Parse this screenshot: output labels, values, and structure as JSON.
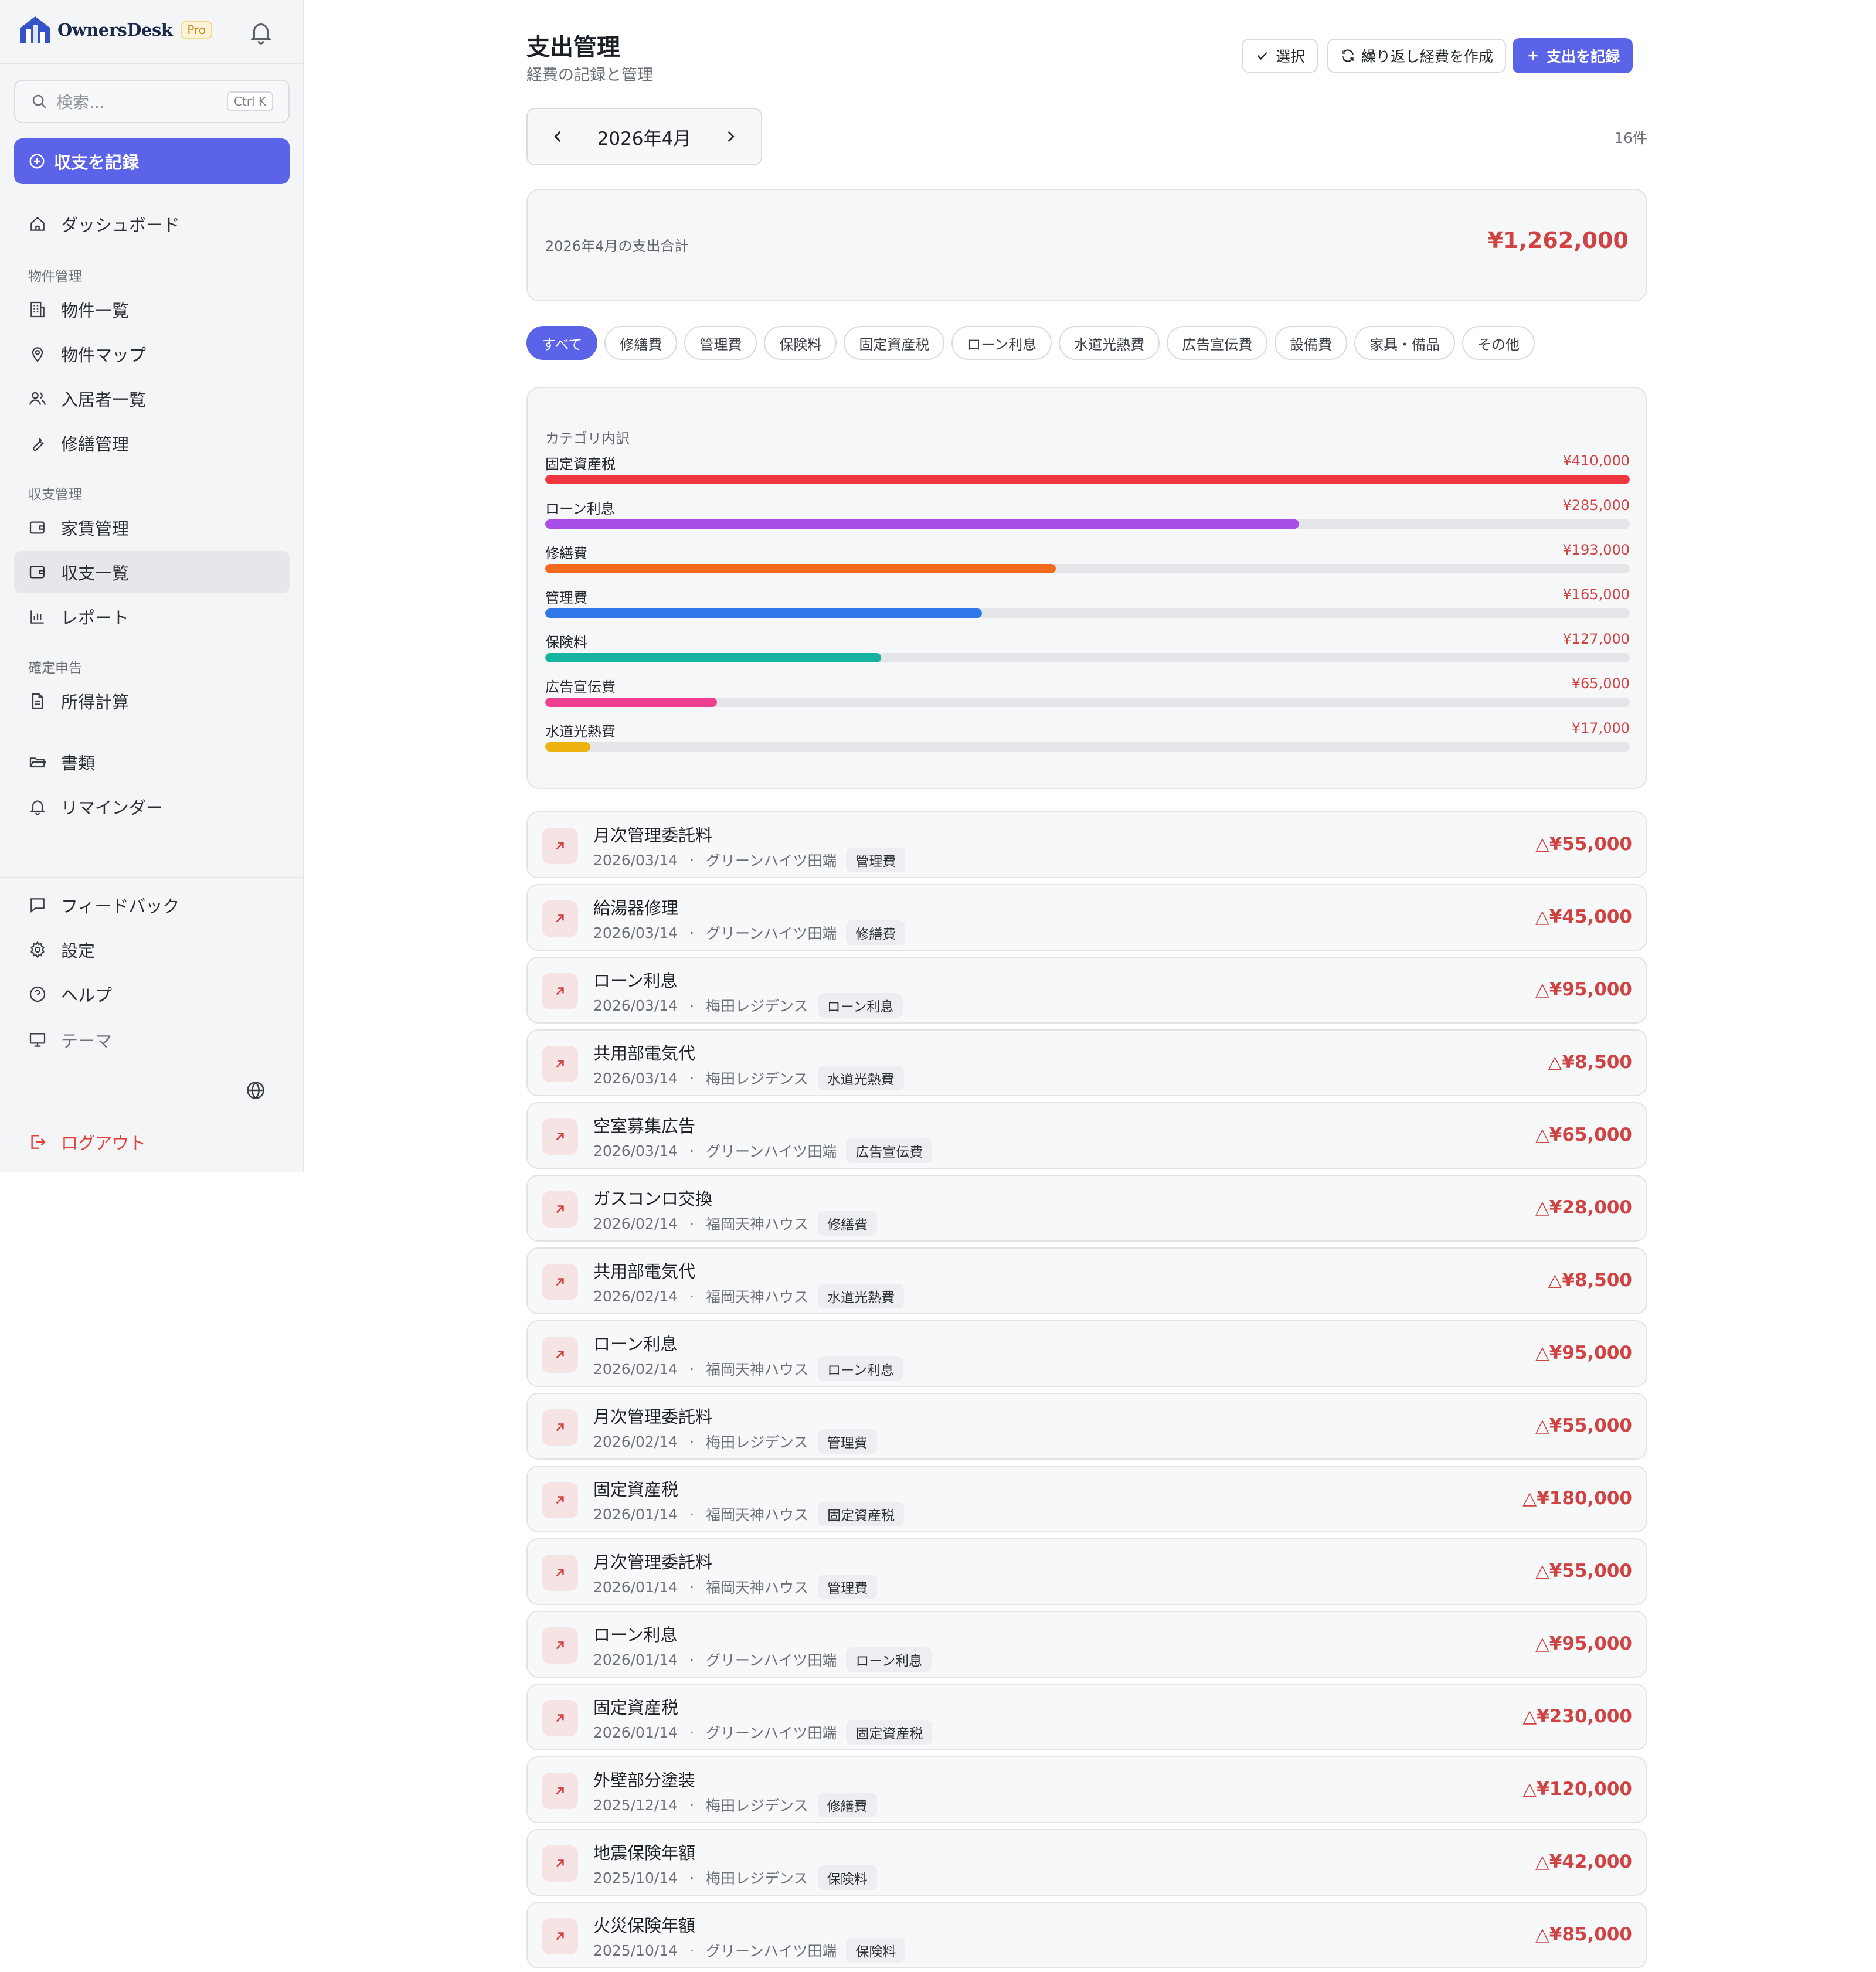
{
  "app": {
    "name": "OwnersDesk",
    "plan_badge": "Pro"
  },
  "search": {
    "placeholder": "検索...",
    "shortcut": "Ctrl K"
  },
  "sidebar": {
    "record_button": "収支を記録",
    "dashboard": "ダッシュボード",
    "section_property": "物件管理",
    "property_list": "物件一覧",
    "property_map": "物件マップ",
    "tenant_list": "入居者一覧",
    "repair": "修繕管理",
    "section_finance": "収支管理",
    "rent": "家賃管理",
    "ledger": "収支一覧",
    "report": "レポート",
    "section_tax": "確定申告",
    "income_calc": "所得計算",
    "documents": "書類",
    "reminder": "リマインダー",
    "feedback": "フィードバック",
    "settings": "設定",
    "help": "ヘルプ",
    "theme": "テーマ",
    "logout": "ログアウト"
  },
  "header": {
    "title": "支出管理",
    "subtitle": "経費の記録と管理",
    "select_button": "選択",
    "recurring_button": "繰り返し経費を作成",
    "record_expense_button": "支出を記録"
  },
  "month": {
    "label": "2026年4月",
    "count": "16件"
  },
  "total": {
    "label": "2026年4月の支出合計",
    "value": "¥1,262,000"
  },
  "filters": [
    "すべて",
    "修繕費",
    "管理費",
    "保険料",
    "固定資産税",
    "ローン利息",
    "水道光熱費",
    "広告宣伝費",
    "設備費",
    "家具・備品",
    "その他"
  ],
  "categories": {
    "title": "カテゴリ内訳",
    "items": [
      {
        "name": "固定資産税",
        "amount": "¥410,000",
        "value": 410000,
        "color": "#f0373f"
      },
      {
        "name": "ローン利息",
        "amount": "¥285,000",
        "value": 285000,
        "color": "#a64ee6"
      },
      {
        "name": "修繕費",
        "amount": "¥193,000",
        "value": 193000,
        "color": "#f46a1d"
      },
      {
        "name": "管理費",
        "amount": "¥165,000",
        "value": 165000,
        "color": "#2f76e8"
      },
      {
        "name": "保険料",
        "amount": "¥127,000",
        "value": 127000,
        "color": "#15b3a0"
      },
      {
        "name": "広告宣伝費",
        "amount": "¥65,000",
        "value": 65000,
        "color": "#ee3f91"
      },
      {
        "name": "水道光熱費",
        "amount": "¥17,000",
        "value": 17000,
        "color": "#eeb20d"
      }
    ]
  },
  "transactions": [
    {
      "title": "月次管理委託料",
      "date": "2026/03/14",
      "property": "グリーンハイツ田端",
      "category": "管理費",
      "amount": "△¥55,000"
    },
    {
      "title": "給湯器修理",
      "date": "2026/03/14",
      "property": "グリーンハイツ田端",
      "category": "修繕費",
      "amount": "△¥45,000"
    },
    {
      "title": "ローン利息",
      "date": "2026/03/14",
      "property": "梅田レジデンス",
      "category": "ローン利息",
      "amount": "△¥95,000"
    },
    {
      "title": "共用部電気代",
      "date": "2026/03/14",
      "property": "梅田レジデンス",
      "category": "水道光熱費",
      "amount": "△¥8,500"
    },
    {
      "title": "空室募集広告",
      "date": "2026/03/14",
      "property": "グリーンハイツ田端",
      "category": "広告宣伝費",
      "amount": "△¥65,000"
    },
    {
      "title": "ガスコンロ交換",
      "date": "2026/02/14",
      "property": "福岡天神ハウス",
      "category": "修繕費",
      "amount": "△¥28,000"
    },
    {
      "title": "共用部電気代",
      "date": "2026/02/14",
      "property": "福岡天神ハウス",
      "category": "水道光熱費",
      "amount": "△¥8,500"
    },
    {
      "title": "ローン利息",
      "date": "2026/02/14",
      "property": "福岡天神ハウス",
      "category": "ローン利息",
      "amount": "△¥95,000"
    },
    {
      "title": "月次管理委託料",
      "date": "2026/02/14",
      "property": "梅田レジデンス",
      "category": "管理費",
      "amount": "△¥55,000"
    },
    {
      "title": "固定資産税",
      "date": "2026/01/14",
      "property": "福岡天神ハウス",
      "category": "固定資産税",
      "amount": "△¥180,000"
    },
    {
      "title": "月次管理委託料",
      "date": "2026/01/14",
      "property": "福岡天神ハウス",
      "category": "管理費",
      "amount": "△¥55,000"
    },
    {
      "title": "ローン利息",
      "date": "2026/01/14",
      "property": "グリーンハイツ田端",
      "category": "ローン利息",
      "amount": "△¥95,000"
    },
    {
      "title": "固定資産税",
      "date": "2026/01/14",
      "property": "グリーンハイツ田端",
      "category": "固定資産税",
      "amount": "△¥230,000"
    },
    {
      "title": "外壁部分塗装",
      "date": "2025/12/14",
      "property": "梅田レジデンス",
      "category": "修繕費",
      "amount": "△¥120,000"
    },
    {
      "title": "地震保険年額",
      "date": "2025/10/14",
      "property": "梅田レジデンス",
      "category": "保険料",
      "amount": "△¥42,000"
    },
    {
      "title": "火災保険年額",
      "date": "2025/10/14",
      "property": "グリーンハイツ田端",
      "category": "保険料",
      "amount": "△¥85,000"
    }
  ],
  "meta_separator": "·"
}
